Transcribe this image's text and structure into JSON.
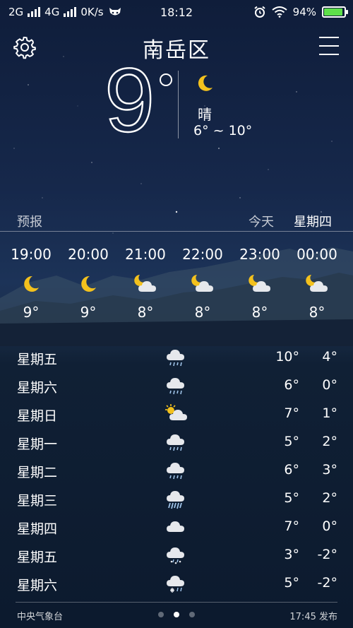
{
  "status_bar": {
    "net1": "2G",
    "net2": "4G",
    "speed": "0K/s",
    "time": "18:12",
    "battery": "94%",
    "battery_level": 0.94,
    "battery_color": "#5ee04a"
  },
  "header": {
    "city": "南岳区",
    "settings_icon": "gear-icon",
    "menu_icon": "hamburger-menu-icon"
  },
  "current": {
    "temp": "9",
    "degree_symbol": "°",
    "condition": "晴",
    "range": "6° ~ 10°",
    "icon": "crescent-moon-icon"
  },
  "forecast_header": {
    "label": "预报",
    "today": "今天",
    "weekday": "星期四"
  },
  "hourly": [
    {
      "time": "19:00",
      "icon": "moon",
      "temp": "9°"
    },
    {
      "time": "20:00",
      "icon": "moon",
      "temp": "9°"
    },
    {
      "time": "21:00",
      "icon": "moon-cloud",
      "temp": "8°"
    },
    {
      "time": "22:00",
      "icon": "moon-cloud",
      "temp": "8°"
    },
    {
      "time": "23:00",
      "icon": "moon-cloud",
      "temp": "8°"
    },
    {
      "time": "00:00",
      "icon": "moon-cloud",
      "temp": "8°"
    }
  ],
  "daily": [
    {
      "day": "星期五",
      "icon": "rain",
      "high": "10°",
      "low": "4°"
    },
    {
      "day": "星期六",
      "icon": "rain",
      "high": "6°",
      "low": "0°"
    },
    {
      "day": "星期日",
      "icon": "sun-cloud",
      "high": "7°",
      "low": "1°"
    },
    {
      "day": "星期一",
      "icon": "rain",
      "high": "5°",
      "low": "2°"
    },
    {
      "day": "星期二",
      "icon": "rain",
      "high": "6°",
      "low": "3°"
    },
    {
      "day": "星期三",
      "icon": "heavy-rain",
      "high": "5°",
      "low": "2°"
    },
    {
      "day": "星期四",
      "icon": "cloud",
      "high": "7°",
      "low": "0°"
    },
    {
      "day": "星期五",
      "icon": "sleet",
      "high": "3°",
      "low": "-2°"
    },
    {
      "day": "星期六",
      "icon": "snow-rain",
      "high": "5°",
      "low": "-2°"
    }
  ],
  "footer": {
    "source": "中央气象台",
    "publish": "17:45 发布",
    "pages": 3,
    "active_page": 1
  }
}
